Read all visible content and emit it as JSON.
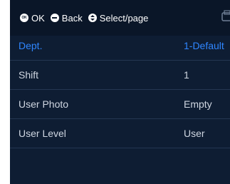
{
  "topbar": {
    "hints": [
      {
        "key": "OK",
        "label": "OK"
      },
      {
        "key": "back",
        "label": "Back"
      },
      {
        "key": "select",
        "label": "Select/page"
      }
    ]
  },
  "menu": {
    "rows": [
      {
        "label": "Dept.",
        "value": "1-Default",
        "selected": true
      },
      {
        "label": "Shift",
        "value": "1"
      },
      {
        "label": "User Photo",
        "value": "Empty"
      },
      {
        "label": "User Level",
        "value": "User"
      }
    ]
  },
  "colors": {
    "background": "#0e1d33",
    "topbar": "#0a1628",
    "selected_text": "#2f86ff",
    "text": "#cfd6e1",
    "divider": "#243652"
  },
  "icons": {
    "ok_button": "ok-button-icon",
    "back_button": "back-button-icon",
    "select_button": "select-button-icon",
    "corner": "printer-icon"
  }
}
